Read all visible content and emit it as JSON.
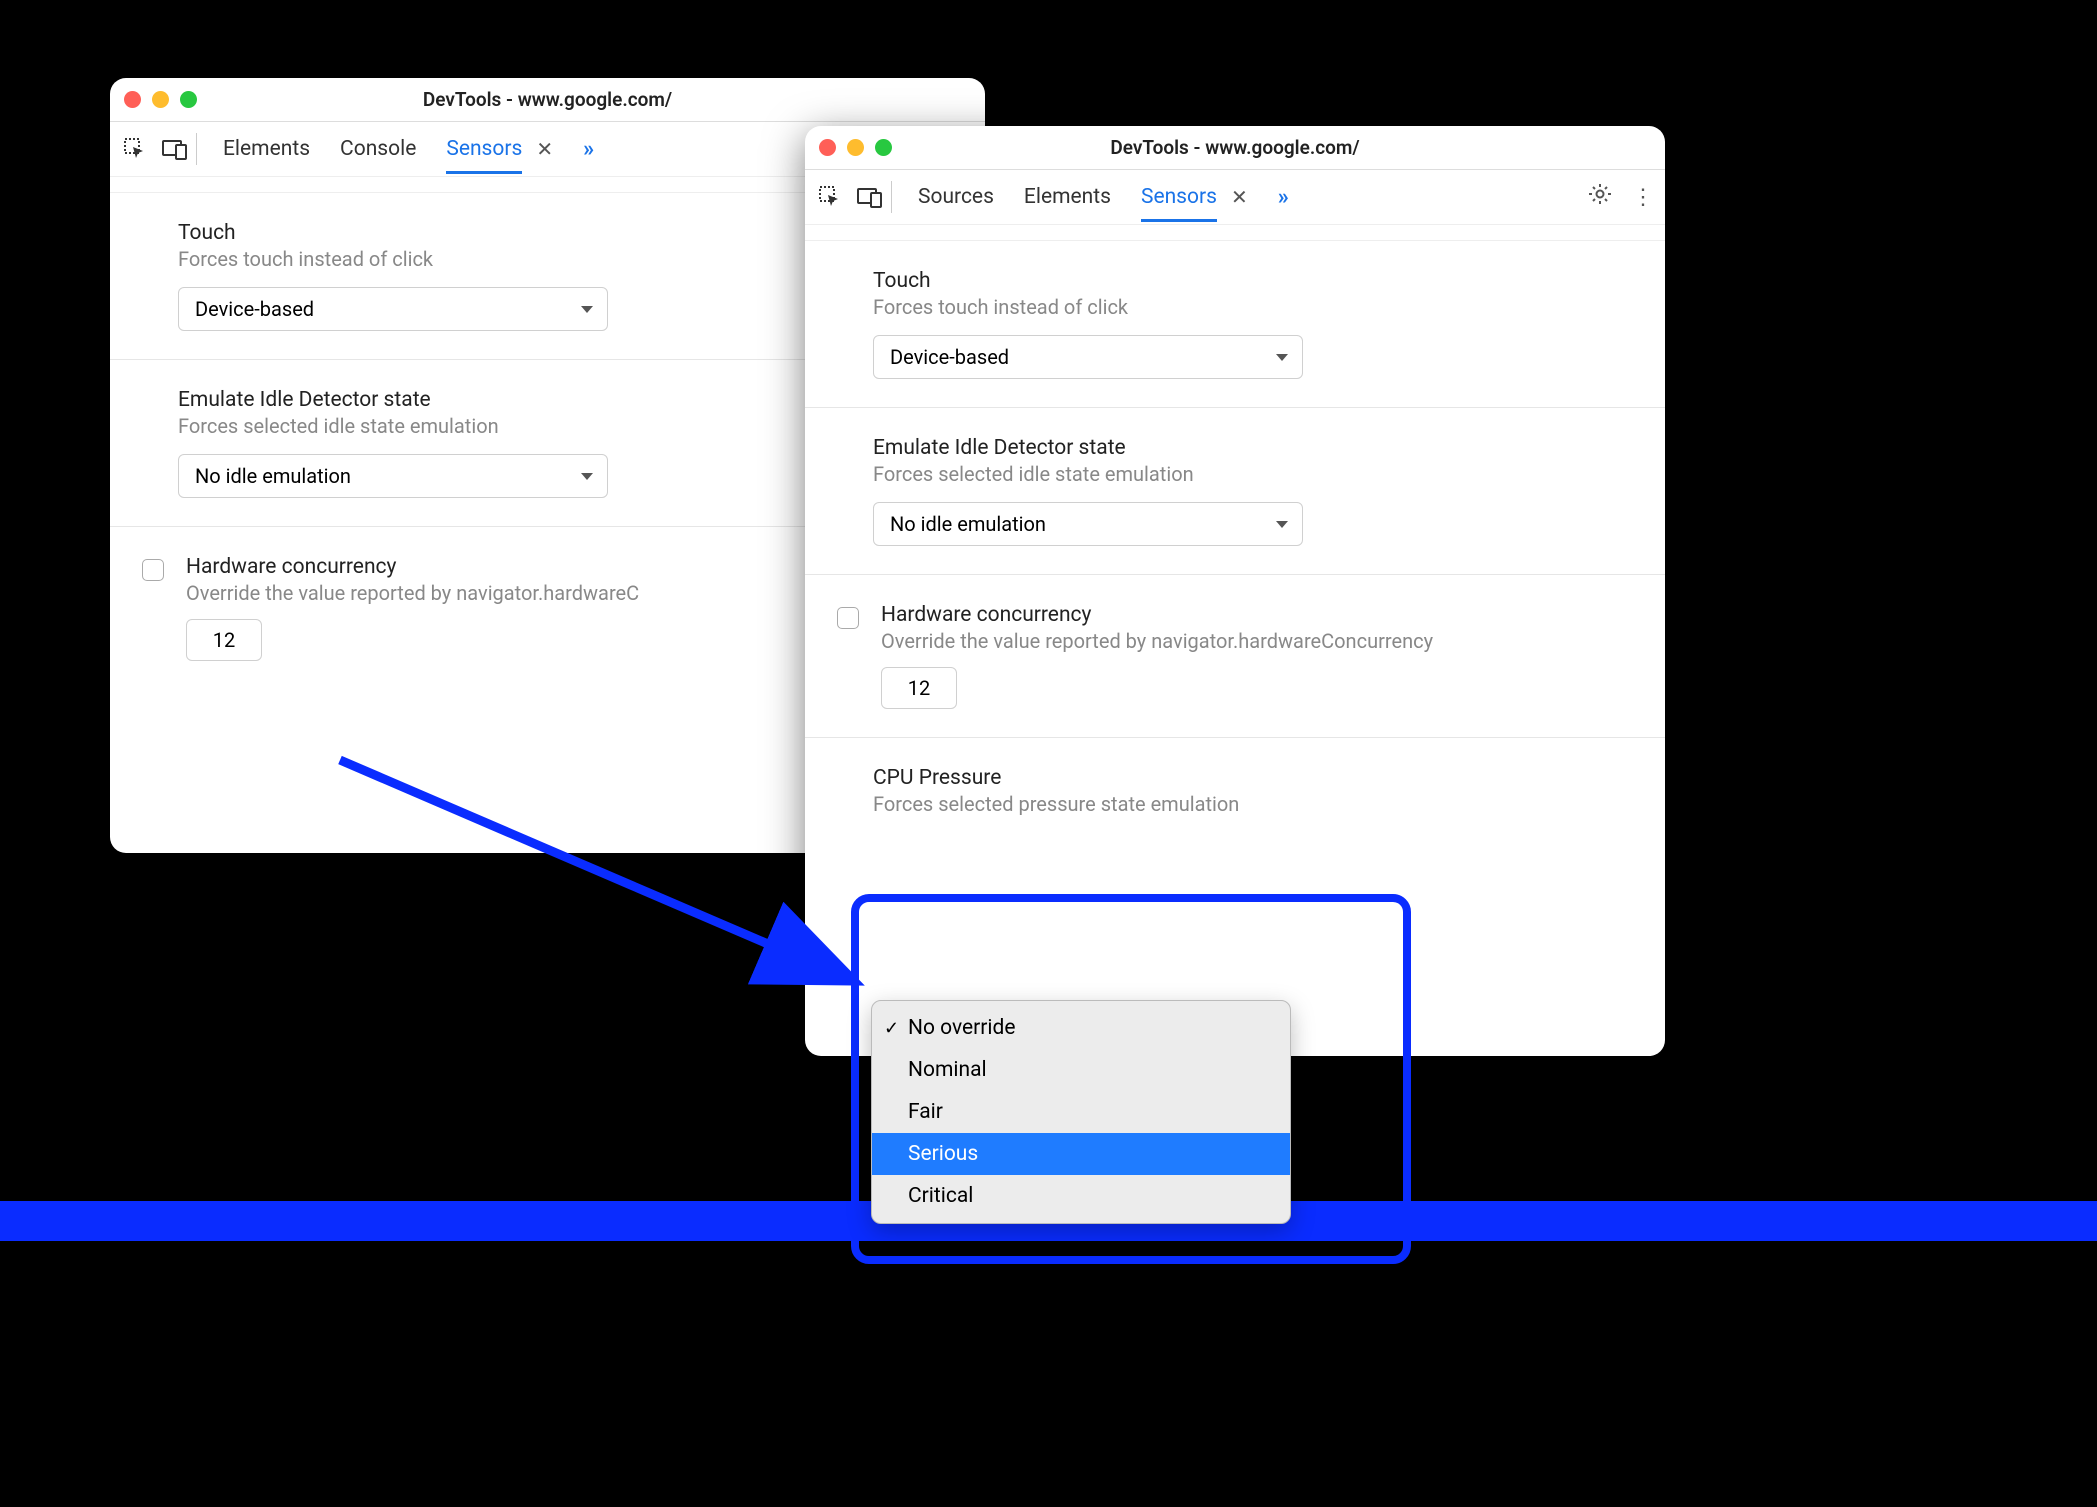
{
  "window1": {
    "title": "DevTools - www.google.com/",
    "tabs": [
      "Elements",
      "Console",
      "Sensors"
    ],
    "active_tab": "Sensors",
    "touch": {
      "title": "Touch",
      "sub": "Forces touch instead of click",
      "value": "Device-based"
    },
    "idle": {
      "title": "Emulate Idle Detector state",
      "sub": "Forces selected idle state emulation",
      "value": "No idle emulation"
    },
    "hw": {
      "title": "Hardware concurrency",
      "sub": "Override the value reported by navigator.hardwareC",
      "value": "12"
    }
  },
  "window2": {
    "title": "DevTools - www.google.com/",
    "tabs": [
      "Sources",
      "Elements",
      "Sensors"
    ],
    "active_tab": "Sensors",
    "touch": {
      "title": "Touch",
      "sub": "Forces touch instead of click",
      "value": "Device-based"
    },
    "idle": {
      "title": "Emulate Idle Detector state",
      "sub": "Forces selected idle state emulation",
      "value": "No idle emulation"
    },
    "hw": {
      "title": "Hardware concurrency",
      "sub": "Override the value reported by navigator.hardwareConcurrency",
      "value": "12"
    },
    "cpu": {
      "title": "CPU Pressure",
      "sub": "Forces selected pressure state emulation"
    }
  },
  "dropdown": {
    "options": [
      "No override",
      "Nominal",
      "Fair",
      "Serious",
      "Critical"
    ],
    "checked": "No override",
    "highlighted": "Serious"
  }
}
